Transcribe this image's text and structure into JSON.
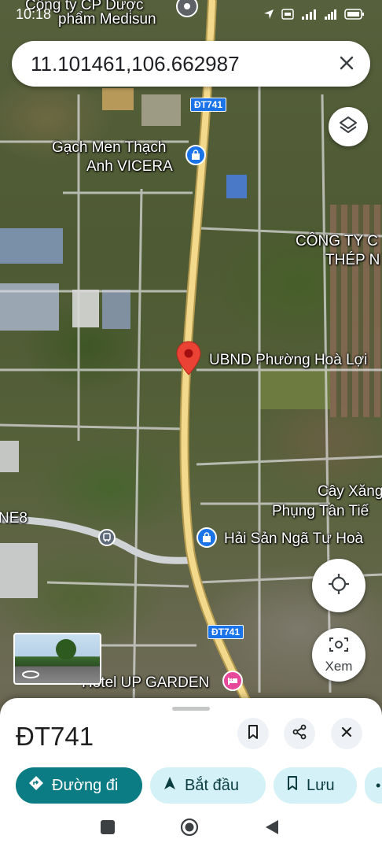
{
  "status_bar": {
    "time": "10:18"
  },
  "search": {
    "query": "11.101461,106.662987"
  },
  "map": {
    "labels": {
      "company_top_line1": "Công ty CP Dược",
      "company_top_line2": "phẩm Medisun",
      "gach_men_line1": "Gạch Men Thạch",
      "gach_men_line2": "Anh VICERA",
      "cong_ty_line1": "CÔNG TY C",
      "cong_ty_line2": "THÉP N",
      "ubnd": "UBND Phường Hoà Lợi",
      "cay_xang_line1": "Cây Xăng",
      "cay_xang_line2": "Phụng Tân Tiế",
      "hai_san": "Hải Sản Ngã Tư Hoà",
      "ne8": "NE8",
      "hotel": "Hotel UP GARDEN"
    },
    "road_shields": [
      "ĐT741",
      "ĐT741"
    ],
    "street_view_label": "Xem"
  },
  "sheet": {
    "title": "ĐT741",
    "chips": {
      "directions": "Đường đi",
      "start": "Bắt đầu",
      "save": "Lưu"
    }
  },
  "colors": {
    "road": "#f3d98b",
    "pin": "#ea4335",
    "directions_chip": "#0b7b84",
    "chip_bg": "#d3f1f6",
    "poi_blue": "#1a73e8",
    "poi_pink": "#e8489a"
  }
}
